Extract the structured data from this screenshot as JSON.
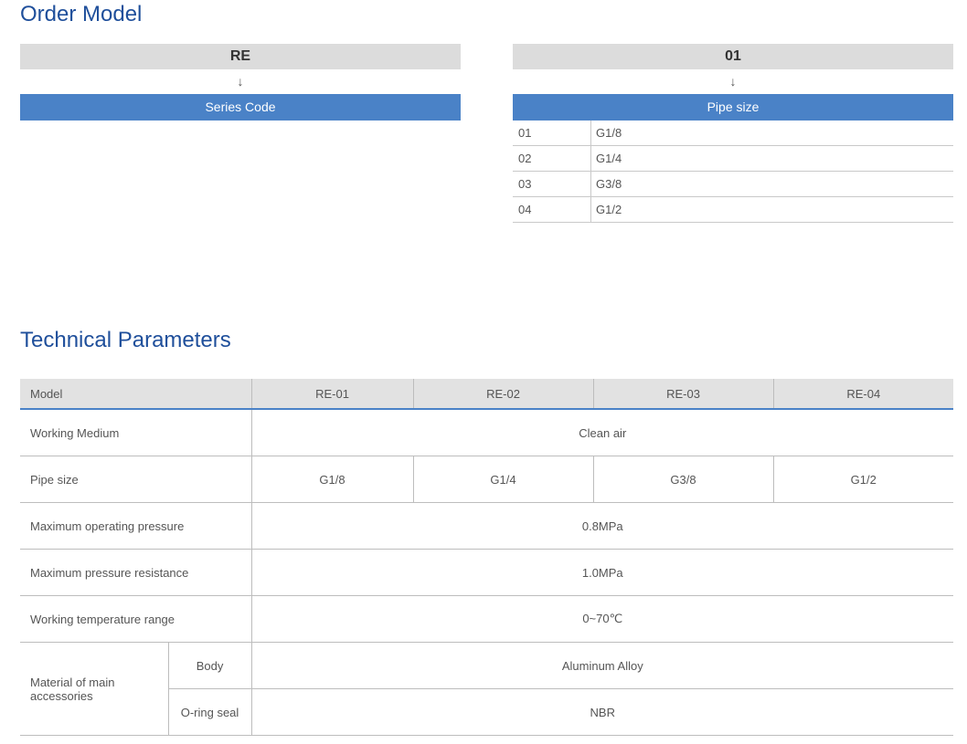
{
  "order_model": {
    "title": "Order Model",
    "left": {
      "code": "RE",
      "arrow": "↓",
      "label": "Series Code"
    },
    "right": {
      "code": "01",
      "arrow": "↓",
      "label": "Pipe size",
      "rows": [
        {
          "code": "01",
          "size": "G1/8"
        },
        {
          "code": "02",
          "size": "G1/4"
        },
        {
          "code": "03",
          "size": "G3/8"
        },
        {
          "code": "04",
          "size": "G1/2"
        }
      ]
    }
  },
  "technical": {
    "title": "Technical Parameters",
    "header": {
      "label": "Model",
      "models": [
        "RE-01",
        "RE-02",
        "RE-03",
        "RE-04"
      ]
    },
    "working_medium": {
      "label": "Working Medium",
      "value": "Clean air"
    },
    "pipe_size": {
      "label": "Pipe size",
      "values": [
        "G1/8",
        "G1/4",
        "G3/8",
        "G1/2"
      ]
    },
    "max_operating_pressure": {
      "label": "Maximum operating pressure",
      "value": "0.8MPa"
    },
    "max_pressure_resistance": {
      "label": "Maximum pressure resistance",
      "value": "1.0MPa"
    },
    "temperature_range": {
      "label": "Working temperature range",
      "value": "0~70℃"
    },
    "material": {
      "label": "Material of main accessories",
      "body": {
        "label": "Body",
        "value": "Aluminum Alloy"
      },
      "oring": {
        "label": "O-ring seal",
        "value": "NBR"
      }
    }
  }
}
